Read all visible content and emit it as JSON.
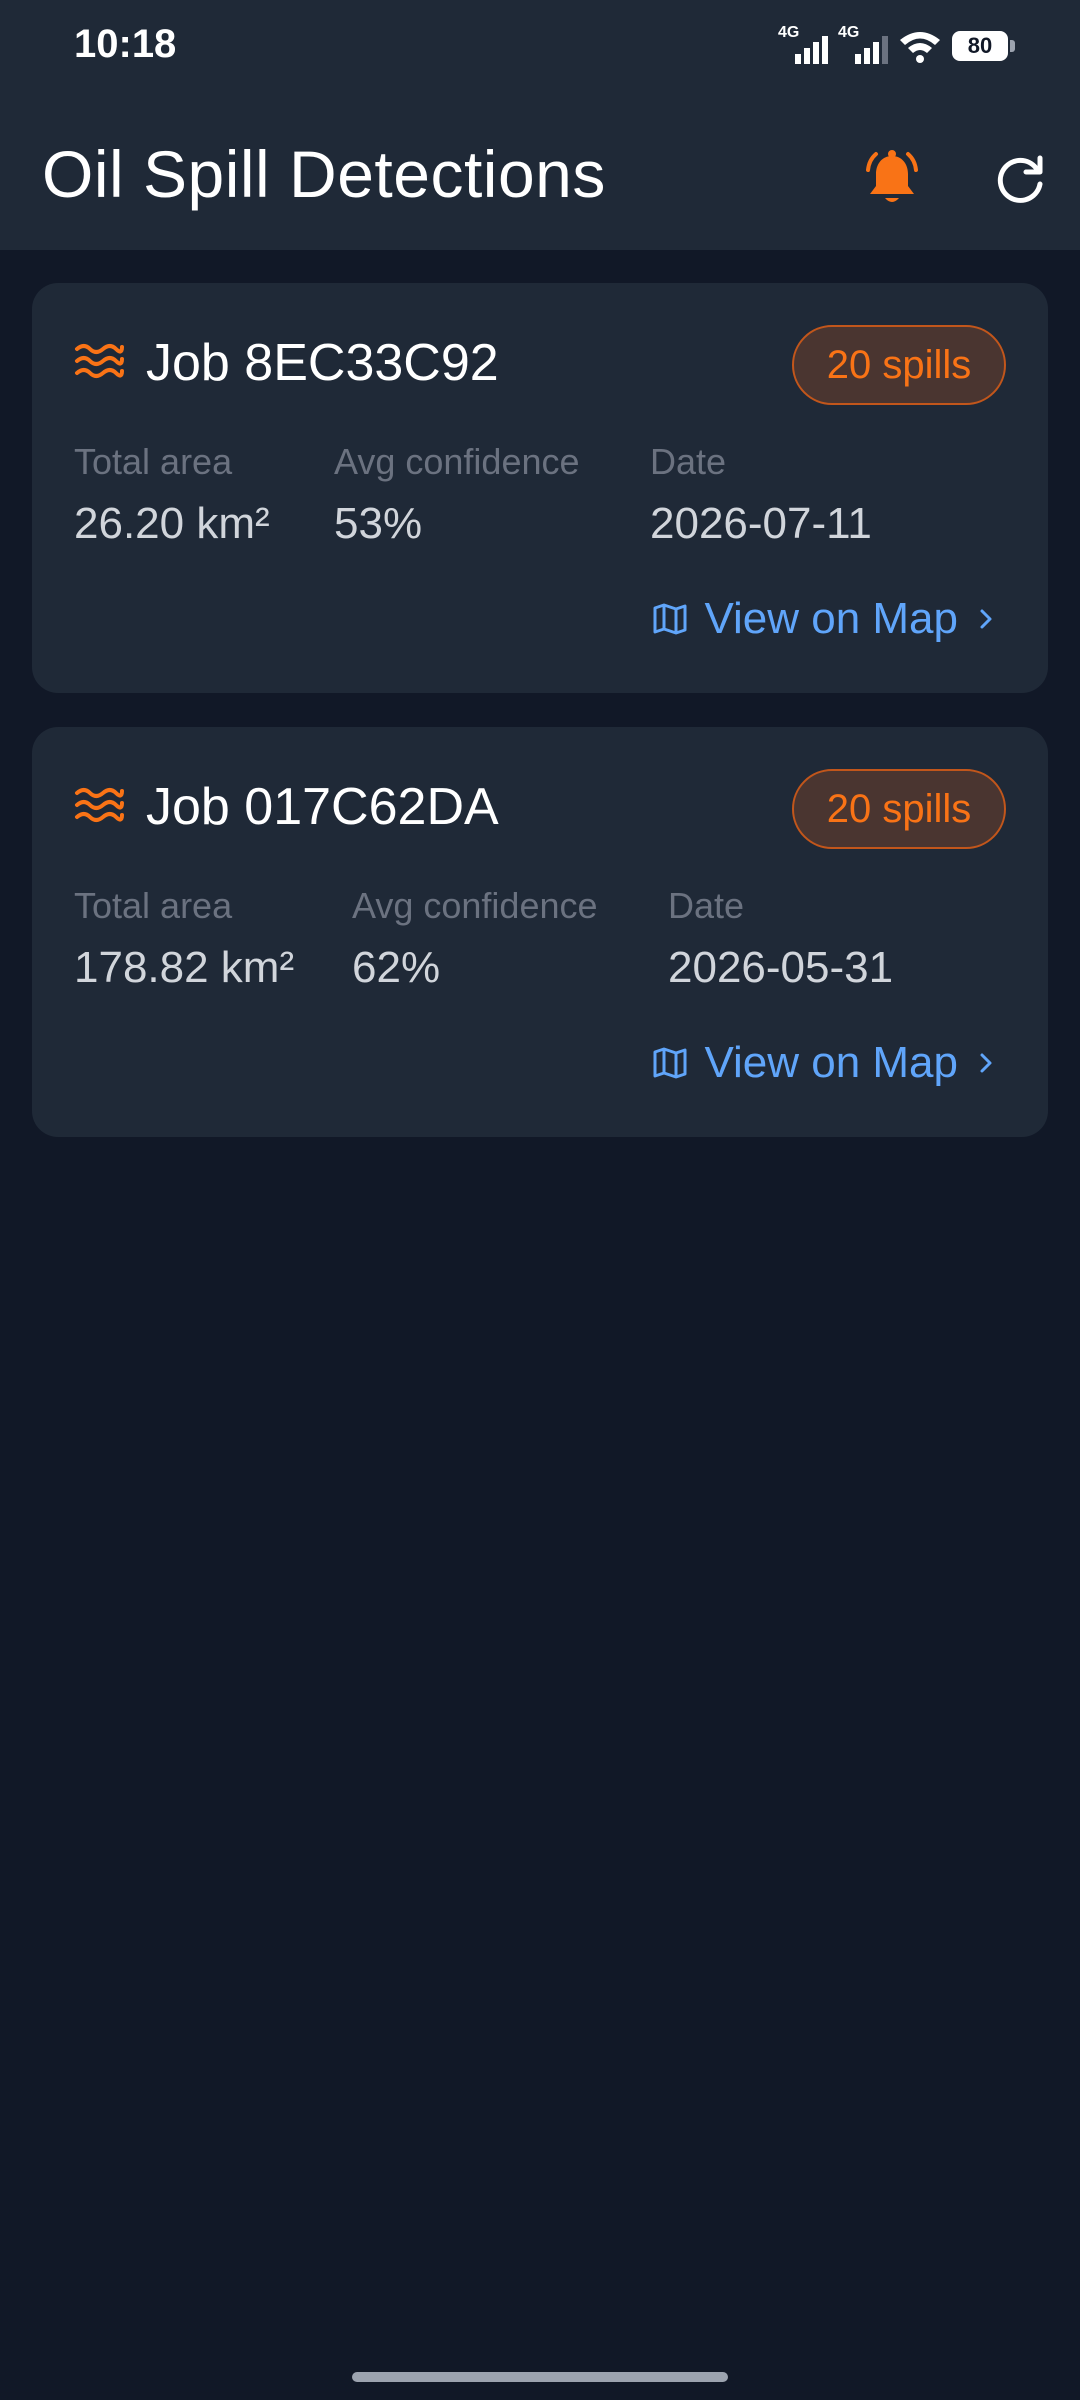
{
  "status_bar": {
    "time": "10:18",
    "network_1": "4G",
    "network_2": "4G",
    "battery": "80"
  },
  "app_bar": {
    "title": "Oil Spill Detections",
    "icons": [
      "bell-icon",
      "refresh-icon"
    ],
    "accent_color": "#f97316"
  },
  "labels": {
    "total_area": "Total area",
    "avg_confidence": "Avg confidence",
    "date": "Date",
    "view_on_map": "View on Map"
  },
  "jobs": [
    {
      "title": "Job 8EC33C92",
      "spills": "20 spills",
      "total_area": "26.20 km²",
      "avg_confidence": "53%",
      "date": "2026-07-11"
    },
    {
      "title": "Job 017C62DA",
      "spills": "20 spills",
      "total_area": "178.82 km²",
      "avg_confidence": "62%",
      "date": "2026-05-31"
    }
  ],
  "colors": {
    "background": "#111827",
    "surface": "#1f2937",
    "link": "#60a5fa",
    "badge_text": "#f97316"
  }
}
